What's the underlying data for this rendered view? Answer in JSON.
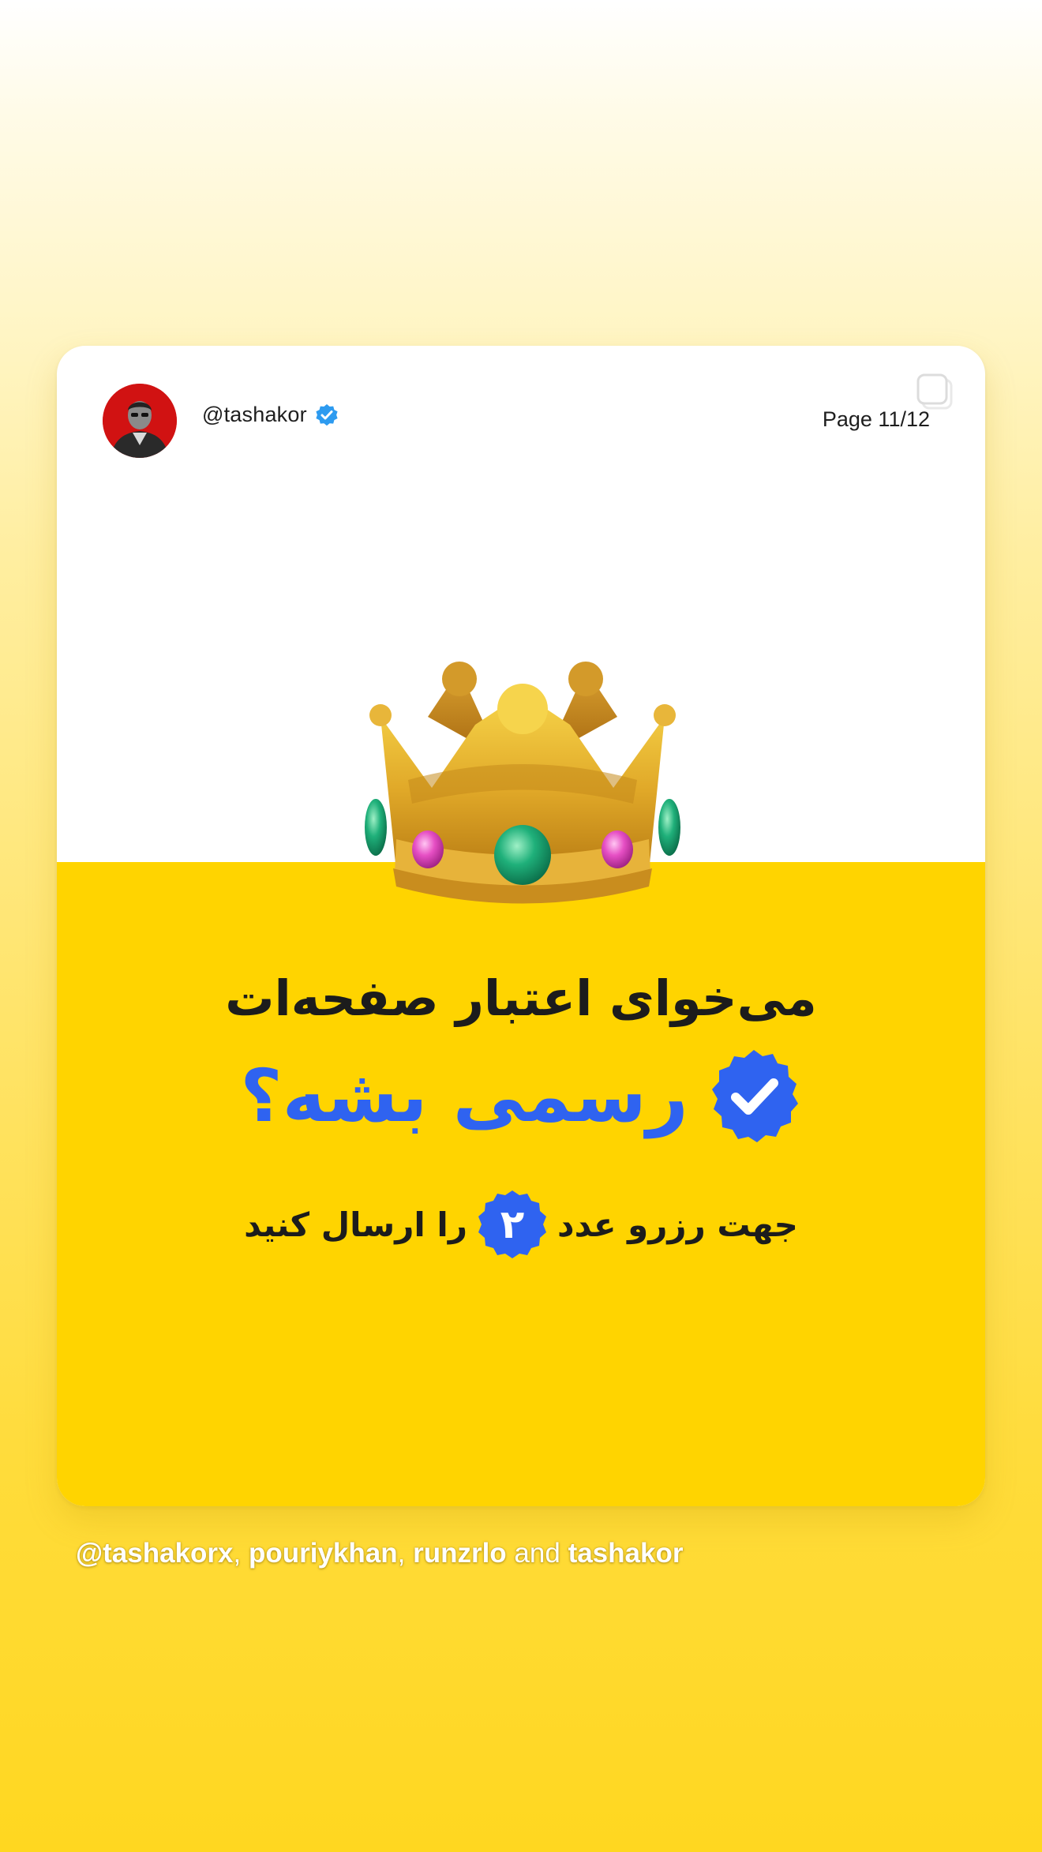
{
  "header": {
    "username": "@tashakor",
    "page_indicator": "Page 11/12"
  },
  "main": {
    "title_line1": "می‌خوای اعتبار صفحه‌ات",
    "title_line2": "رسمی بشه؟",
    "instruction_before": "جهت رزرو عدد",
    "instruction_number": "۲",
    "instruction_after": "را ارسال کنید"
  },
  "mentions": {
    "first": "@tashakorx",
    "comma1": ",",
    "second": "pouriykhan",
    "comma2": ",",
    "third": "runzrlo",
    "and": "and",
    "fourth": "tashakor"
  },
  "colors": {
    "accent_blue": "#2f63f0",
    "card_yellow": "#ffd400",
    "verified_blue": "#2d9bf0"
  },
  "icons": {
    "avatar": "profile-photo",
    "verified": "verified-badge-icon",
    "corner": "multi-image-icon",
    "crown": "crown-emoji",
    "badge": "verified-check-badge"
  }
}
